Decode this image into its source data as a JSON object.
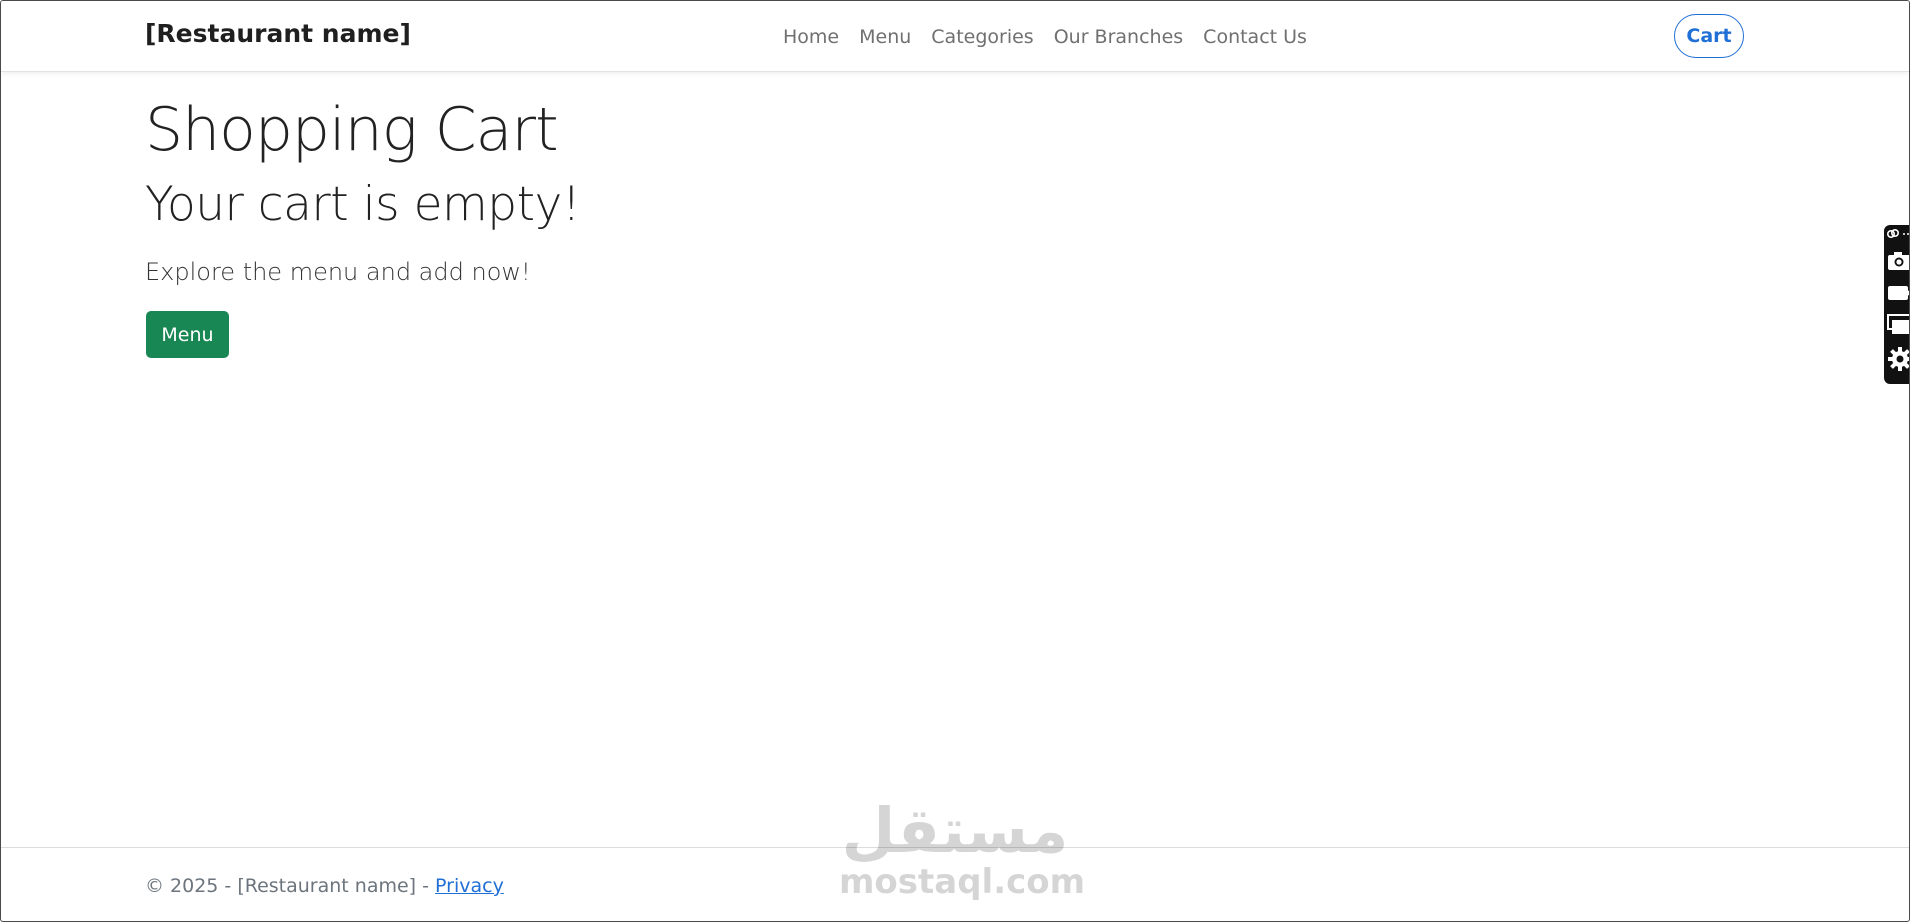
{
  "navbar": {
    "brand": "[Restaurant name]",
    "links": [
      {
        "label": "Home"
      },
      {
        "label": "Menu"
      },
      {
        "label": "Categories"
      },
      {
        "label": "Our Branches"
      },
      {
        "label": "Contact Us"
      }
    ],
    "cart_label": "Cart"
  },
  "main": {
    "title": "Shopping Cart",
    "empty_heading": "Your cart is empty!",
    "lead": "Explore the menu and add now!",
    "menu_button": "Menu"
  },
  "footer": {
    "copyright": "© 2025 - [Restaurant name] - ",
    "privacy_link": "Privacy"
  },
  "watermark": {
    "arabic": "مستقل",
    "latin": "mostaql.com"
  },
  "side_toolbar": {
    "icons": [
      "link-icon",
      "camera-icon",
      "video-icon",
      "screens-icon",
      "gear-icon"
    ]
  },
  "colors": {
    "primary": "#1f6fd6",
    "success": "#198754",
    "nav_text": "#707070",
    "footer_text": "#6c757d"
  }
}
